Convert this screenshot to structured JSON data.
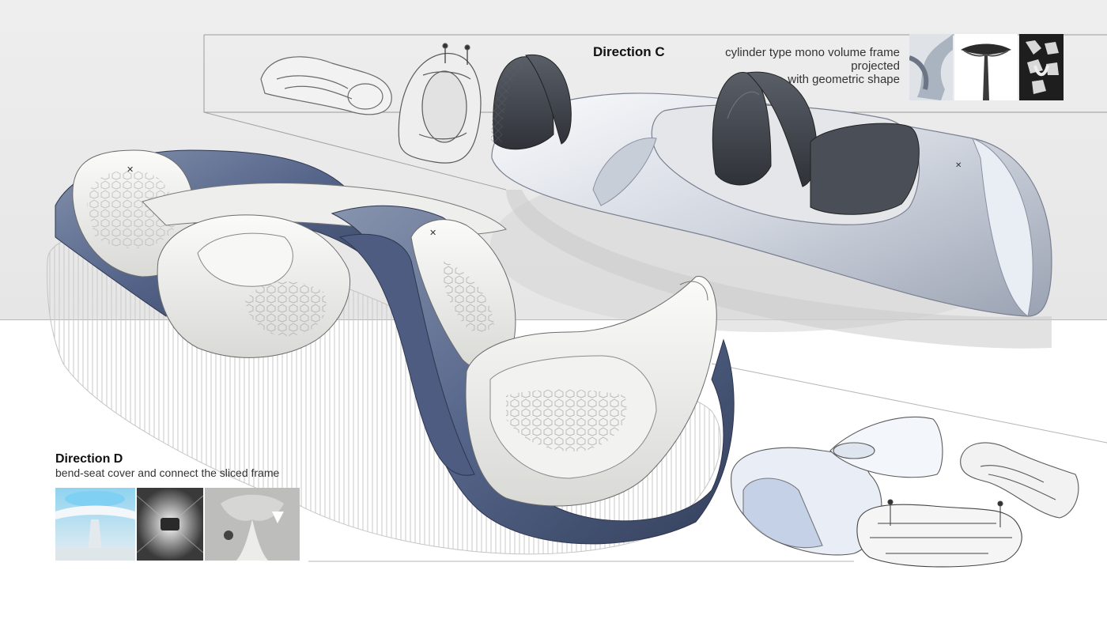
{
  "direction_c": {
    "title": "Direction C",
    "description_line1": "cylinder type mono volume frame projected",
    "description_line2": "with geometric shape",
    "reference_images": [
      "twisted-sculpture-photo",
      "streetlamp-canopy-photo",
      "voronoi-lattice-photo"
    ]
  },
  "direction_d": {
    "title": "Direction D",
    "description": "bend-seat cover and connect the sliced frame",
    "reference_images": [
      "canopy-atrium-photo",
      "wall-lamp-photo",
      "organic-interior-photo"
    ]
  },
  "colors": {
    "background_top": "#e8e8e8",
    "background_bottom": "#ffffff",
    "frame_blue": "#5b6b8c",
    "seat_white": "#f4f4f2",
    "seat_dark": "#3d4148",
    "sketch_line": "#555555"
  }
}
